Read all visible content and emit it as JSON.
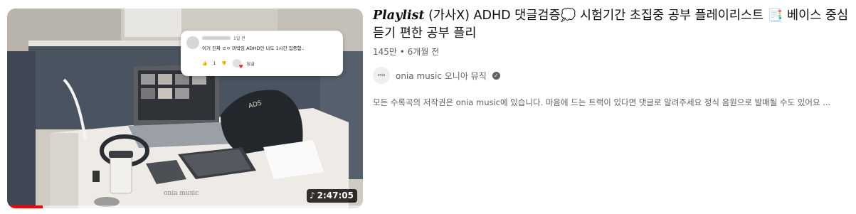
{
  "video": {
    "title_playlist": "Playlist",
    "title_rest": " (가사X) ADHD 댓글검증💭 시험기간 초집중 공부 플레이리스트 📑 베이스 중심 듣기 편한 공부 플리",
    "views": "145만",
    "separator": " • ",
    "age": "6개월 전",
    "duration": "2:47:05",
    "duration_icon": "music-note-icon",
    "watch_progress": 0.1,
    "watermark": "onia music",
    "channel_name": "onia music 오니아 뮤직",
    "channel_avatar_text": "onia",
    "verified_icon": "verified-check-icon",
    "description": "모든 수록곡의 저작권은 onia music에 있습니다. 마음에 드는 트랙이 있다면 댓글로 알려주세요 정식 음원으로 발매될 수도 있어요 ..."
  },
  "comment_overlay": {
    "time": "1일 전",
    "text": "이거 진짜 ㄹㅇ 미박임 ADHD인 나도 1시간 집중함..",
    "like_count": "1",
    "reply_label": "답글"
  },
  "colors": {
    "meta_text": "#606060",
    "title_text": "#0f0f0f",
    "progress": "#ff0000"
  }
}
